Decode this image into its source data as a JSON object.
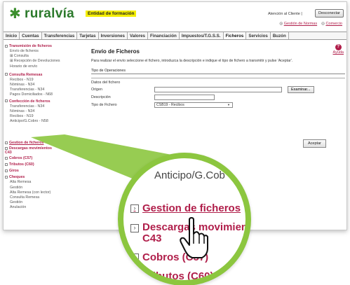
{
  "header": {
    "logo_text": "ruralvía",
    "logo_icon": "star-icon",
    "entity_label": "Entidad de formación",
    "atencion_label": "Atención al Cliente |",
    "disconnect_label": "Desconectar",
    "links": [
      "Gestión de Normas",
      "Comercio"
    ]
  },
  "tabs": [
    "Inicio",
    "Cuentas",
    "Transferencias",
    "Tarjetas",
    "Inversiones",
    "Valores",
    "Financiación",
    "Impuestos/T.G.S.S.",
    "Ficheros",
    "Servicios",
    "Buzón"
  ],
  "active_tab": "Ficheros",
  "sidebar": {
    "sections": [
      {
        "title": "Transmisión de ficheros",
        "items": [
          "Envío de ficheros",
          "⊞ Consulta",
          "⊞ Recepción de Devoluciones",
          "Horario de envío"
        ]
      },
      {
        "title": "Consulta Remesas",
        "items": [
          "Recibos - N19",
          "Nóminas - N34",
          "Transferencias - N34",
          "Pagos Domiciliados - N68"
        ]
      },
      {
        "title": "Confección de ficheros",
        "items": [
          "Transferencias - N34",
          "Nóminas - N34",
          "Recibos - N19",
          "Anticipo/G.Cobro - N58"
        ]
      },
      {
        "title": "Gestion de ficheros",
        "items": []
      },
      {
        "title": "Descargas movimientos C43",
        "items": []
      },
      {
        "title": "Cobros (C57)",
        "items": []
      },
      {
        "title": "Tributos (C60)",
        "items": []
      },
      {
        "title": "Giros",
        "items": []
      },
      {
        "title": "Cheques",
        "items": [
          "Alta Remesa",
          "Gestión",
          "Alta Remesa (con lector)",
          "Consulta Remesa",
          "Gestión",
          "Anulación"
        ]
      }
    ]
  },
  "main": {
    "title": "Envío de Ficheros",
    "help_label": "Ayuda",
    "intro": "Para realizar el envío seleccione el fichero, introduzca la descripción e indique el tipo de fichero a transmitir y pulse 'Aceptar'.",
    "ops_label": "Tipo de Operaciones",
    "panel_title": "Datos del fichero",
    "origen_label": "Origen",
    "origen_value": "",
    "examinar_label": "Examinar...",
    "descripcion_label": "Descripción",
    "descripcion_value": "",
    "tipo_label": "Tipo de Fichero",
    "tipo_value": "CSB19 - Recibos",
    "aceptar_label": "Aceptar"
  },
  "magnifier": {
    "anticipo": "Anticipo/G.Cob",
    "gestion": "Gestion de ficheros",
    "descargas_line1": "Descargas movimien",
    "descargas_line2": "C43",
    "cobros": "Cobros (C57)",
    "tributos": "ributos (C60)"
  },
  "colors": {
    "brand_green": "#8cc63f",
    "link_red": "#b01e4a",
    "highlight_yellow": "#f4ee00"
  }
}
